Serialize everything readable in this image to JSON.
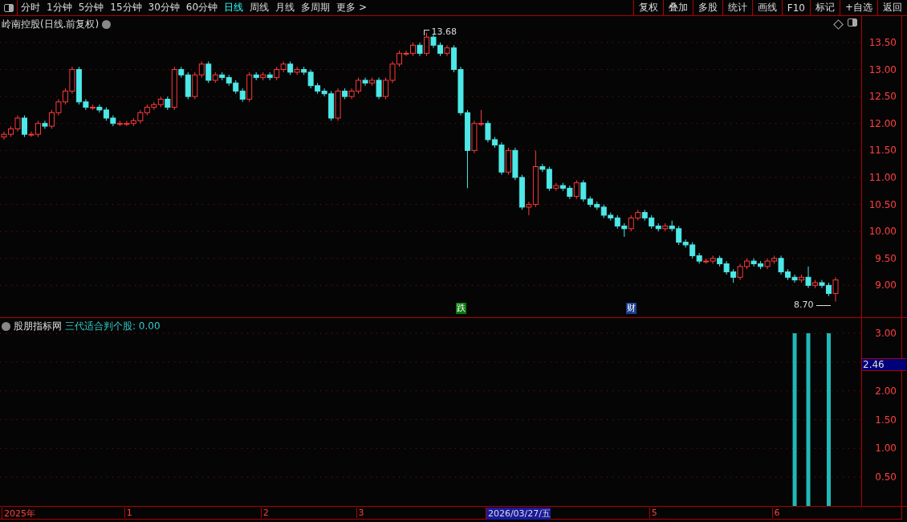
{
  "toolbar": {
    "periods": [
      {
        "label": "分时",
        "selected": false
      },
      {
        "label": "1分钟",
        "selected": false
      },
      {
        "label": "5分钟",
        "selected": false
      },
      {
        "label": "15分钟",
        "selected": false
      },
      {
        "label": "30分钟",
        "selected": false
      },
      {
        "label": "60分钟",
        "selected": false
      },
      {
        "label": "日线",
        "selected": true
      },
      {
        "label": "周线",
        "selected": false
      },
      {
        "label": "月线",
        "selected": false
      },
      {
        "label": "多周期",
        "selected": false
      }
    ],
    "more": "更多 >",
    "actions": [
      "复权",
      "叠加",
      "多股",
      "统计",
      "画线",
      "F10",
      "标记",
      "+自选",
      "返回"
    ]
  },
  "main_panel": {
    "title": "岭南控股(日线.前复权)",
    "chart_data": {
      "type": "candlestick",
      "grid": true,
      "ylim": [
        8.41,
        13.99
      ],
      "yticks": [
        {
          "value": 9,
          "label": "9.00"
        },
        {
          "value": 9.5,
          "label": "9.50"
        },
        {
          "value": 10,
          "label": "10.00"
        },
        {
          "value": 10.5,
          "label": "10.50"
        },
        {
          "value": 11,
          "label": "11.00"
        },
        {
          "value": 11.5,
          "label": "11.50"
        },
        {
          "value": 12,
          "label": "12.00"
        },
        {
          "value": 12.5,
          "label": "12.50"
        },
        {
          "value": 13,
          "label": "13.00"
        },
        {
          "value": 13.5,
          "label": "13.50"
        }
      ],
      "categories": [
        null,
        null,
        null,
        null,
        null,
        null,
        null,
        null,
        null,
        null,
        null,
        null,
        null,
        null,
        null,
        null,
        null,
        null,
        null,
        null,
        null,
        null,
        null,
        null,
        null,
        null,
        null,
        null,
        null,
        null,
        null,
        null,
        null,
        null,
        null,
        null,
        null,
        null,
        null,
        null,
        null,
        null,
        null,
        null,
        null,
        null,
        null,
        null,
        null,
        null,
        null,
        null,
        null,
        null,
        null,
        null,
        null,
        null,
        null,
        null,
        null,
        null,
        null,
        null,
        null,
        null,
        null,
        null,
        null,
        null,
        null,
        null,
        null,
        null,
        null,
        null,
        null,
        null,
        null,
        null,
        null,
        null,
        null,
        null,
        null,
        null,
        null,
        null,
        null,
        null,
        null,
        null,
        null,
        null,
        null,
        null,
        null,
        null,
        null,
        null,
        null,
        null,
        null,
        null,
        null,
        null,
        null,
        null,
        null,
        null,
        null,
        null,
        null,
        null,
        null,
        null,
        null,
        null,
        null,
        null,
        null,
        null,
        null
      ],
      "ohlc": [
        [
          11.75,
          11.85,
          11.7,
          11.8
        ],
        [
          11.8,
          11.95,
          11.75,
          11.9
        ],
        [
          11.9,
          12.15,
          11.85,
          12.1
        ],
        [
          12.1,
          12.15,
          11.75,
          11.8
        ],
        [
          11.8,
          11.85,
          11.75,
          11.8
        ],
        [
          11.8,
          12.05,
          11.75,
          12.0
        ],
        [
          12.0,
          12.05,
          11.9,
          11.95
        ],
        [
          11.95,
          12.25,
          11.9,
          12.2
        ],
        [
          12.2,
          12.45,
          12.15,
          12.4
        ],
        [
          12.4,
          12.65,
          12.35,
          12.6
        ],
        [
          12.6,
          13.05,
          12.55,
          13.0
        ],
        [
          13.0,
          13.05,
          12.35,
          12.4
        ],
        [
          12.4,
          12.45,
          12.25,
          12.3
        ],
        [
          12.3,
          12.35,
          12.25,
          12.3
        ],
        [
          12.3,
          12.35,
          12.2,
          12.25
        ],
        [
          12.25,
          12.3,
          12.05,
          12.1
        ],
        [
          12.1,
          12.15,
          11.95,
          12.0
        ],
        [
          12.0,
          12.05,
          11.95,
          12.0
        ],
        [
          12.0,
          12.05,
          11.95,
          12.0
        ],
        [
          12.0,
          12.1,
          11.95,
          12.05
        ],
        [
          12.05,
          12.25,
          12.0,
          12.2
        ],
        [
          12.2,
          12.35,
          12.15,
          12.3
        ],
        [
          12.3,
          12.4,
          12.25,
          12.35
        ],
        [
          12.35,
          12.5,
          12.3,
          12.45
        ],
        [
          12.45,
          12.5,
          12.25,
          12.3
        ],
        [
          12.3,
          13.05,
          12.25,
          13.0
        ],
        [
          13.0,
          13.05,
          12.85,
          12.9
        ],
        [
          12.9,
          12.95,
          12.45,
          12.5
        ],
        [
          12.5,
          12.95,
          12.45,
          12.9
        ],
        [
          12.9,
          13.15,
          12.85,
          13.1
        ],
        [
          13.1,
          13.15,
          12.75,
          12.8
        ],
        [
          12.8,
          12.95,
          12.75,
          12.9
        ],
        [
          12.9,
          12.95,
          12.8,
          12.85
        ],
        [
          12.85,
          12.9,
          12.7,
          12.75
        ],
        [
          12.75,
          12.8,
          12.55,
          12.6
        ],
        [
          12.6,
          12.65,
          12.4,
          12.45
        ],
        [
          12.45,
          12.95,
          12.4,
          12.9
        ],
        [
          12.9,
          12.95,
          12.8,
          12.85
        ],
        [
          12.85,
          12.95,
          12.8,
          12.9
        ],
        [
          12.9,
          12.95,
          12.8,
          12.85
        ],
        [
          12.85,
          13.05,
          12.8,
          13.0
        ],
        [
          13.0,
          13.15,
          12.95,
          13.1
        ],
        [
          13.1,
          13.15,
          12.9,
          12.95
        ],
        [
          12.95,
          13.05,
          12.9,
          13.0
        ],
        [
          13.0,
          13.05,
          12.9,
          12.95
        ],
        [
          12.95,
          13.0,
          12.65,
          12.7
        ],
        [
          12.7,
          12.75,
          12.55,
          12.6
        ],
        [
          12.6,
          12.65,
          12.5,
          12.55
        ],
        [
          12.55,
          12.6,
          12.05,
          12.1
        ],
        [
          12.1,
          12.65,
          12.05,
          12.6
        ],
        [
          12.6,
          12.65,
          12.45,
          12.5
        ],
        [
          12.5,
          12.65,
          12.45,
          12.6
        ],
        [
          12.6,
          12.85,
          12.55,
          12.8
        ],
        [
          12.8,
          12.85,
          12.7,
          12.75
        ],
        [
          12.75,
          12.85,
          12.7,
          12.8
        ],
        [
          12.8,
          12.85,
          12.45,
          12.5
        ],
        [
          12.5,
          12.85,
          12.45,
          12.8
        ],
        [
          12.8,
          13.15,
          12.75,
          13.1
        ],
        [
          13.1,
          13.35,
          13.05,
          13.3
        ],
        [
          13.3,
          13.35,
          13.25,
          13.3
        ],
        [
          13.3,
          13.5,
          13.25,
          13.45
        ],
        [
          13.45,
          13.5,
          13.25,
          13.3
        ],
        [
          13.3,
          13.68,
          13.25,
          13.6
        ],
        [
          13.6,
          13.65,
          13.4,
          13.45
        ],
        [
          13.45,
          13.5,
          13.25,
          13.3
        ],
        [
          13.3,
          13.45,
          13.25,
          13.4
        ],
        [
          13.4,
          13.45,
          12.95,
          13.0
        ],
        [
          13.0,
          13.05,
          12.15,
          12.2
        ],
        [
          12.2,
          12.25,
          10.8,
          11.5
        ],
        [
          11.5,
          12.05,
          11.45,
          12.0
        ],
        [
          12.0,
          12.25,
          11.95,
          12.0
        ],
        [
          12.0,
          12.05,
          11.65,
          11.7
        ],
        [
          11.7,
          11.75,
          11.55,
          11.6
        ],
        [
          11.6,
          11.65,
          11.05,
          11.1
        ],
        [
          11.1,
          11.55,
          11.05,
          11.5
        ],
        [
          11.5,
          11.55,
          10.95,
          11.0
        ],
        [
          11.0,
          11.05,
          10.4,
          10.45
        ],
        [
          10.45,
          10.55,
          10.3,
          10.5
        ],
        [
          10.5,
          11.5,
          10.45,
          11.2
        ],
        [
          11.2,
          11.25,
          11.1,
          11.15
        ],
        [
          11.15,
          11.2,
          10.75,
          10.8
        ],
        [
          10.8,
          10.9,
          10.75,
          10.85
        ],
        [
          10.85,
          10.9,
          10.75,
          10.8
        ],
        [
          10.8,
          10.85,
          10.6,
          10.65
        ],
        [
          10.65,
          10.95,
          10.6,
          10.9
        ],
        [
          10.9,
          10.95,
          10.55,
          10.6
        ],
        [
          10.6,
          10.65,
          10.45,
          10.5
        ],
        [
          10.5,
          10.55,
          10.4,
          10.45
        ],
        [
          10.45,
          10.5,
          10.25,
          10.3
        ],
        [
          10.3,
          10.35,
          10.2,
          10.25
        ],
        [
          10.25,
          10.3,
          10.05,
          10.1
        ],
        [
          10.1,
          10.15,
          9.9,
          10.05
        ],
        [
          10.05,
          10.3,
          10.0,
          10.25
        ],
        [
          10.25,
          10.4,
          10.2,
          10.35
        ],
        [
          10.35,
          10.4,
          10.2,
          10.25
        ],
        [
          10.25,
          10.3,
          10.05,
          10.1
        ],
        [
          10.1,
          10.15,
          10.0,
          10.05
        ],
        [
          10.05,
          10.15,
          10.0,
          10.1
        ],
        [
          10.1,
          10.2,
          10.0,
          10.05
        ],
        [
          10.05,
          10.1,
          9.75,
          9.8
        ],
        [
          9.8,
          9.85,
          9.7,
          9.75
        ],
        [
          9.75,
          9.8,
          9.5,
          9.55
        ],
        [
          9.55,
          9.6,
          9.4,
          9.45
        ],
        [
          9.45,
          9.5,
          9.4,
          9.45
        ],
        [
          9.45,
          9.55,
          9.4,
          9.5
        ],
        [
          9.5,
          9.55,
          9.35,
          9.4
        ],
        [
          9.4,
          9.45,
          9.2,
          9.25
        ],
        [
          9.25,
          9.3,
          9.05,
          9.15
        ],
        [
          9.15,
          9.4,
          9.1,
          9.35
        ],
        [
          9.35,
          9.5,
          9.3,
          9.45
        ],
        [
          9.45,
          9.5,
          9.35,
          9.4
        ],
        [
          9.4,
          9.45,
          9.3,
          9.35
        ],
        [
          9.35,
          9.5,
          9.3,
          9.45
        ],
        [
          9.45,
          9.55,
          9.4,
          9.5
        ],
        [
          9.5,
          9.55,
          9.2,
          9.25
        ],
        [
          9.25,
          9.3,
          9.1,
          9.15
        ],
        [
          9.15,
          9.2,
          9.05,
          9.1
        ],
        [
          9.1,
          9.2,
          9.05,
          9.15
        ],
        [
          9.15,
          9.35,
          8.95,
          9.0
        ],
        [
          9.0,
          9.1,
          8.95,
          9.05
        ],
        [
          9.05,
          9.1,
          8.95,
          9.0
        ],
        [
          9.0,
          9.05,
          8.8,
          8.85
        ],
        [
          8.85,
          9.15,
          8.7,
          9.1
        ]
      ],
      "annotations": [
        "13.68",
        "8.70"
      ]
    },
    "events": [
      {
        "label": "跌",
        "color": "#0a7a0a"
      },
      {
        "label": "财",
        "color": "#1a3f8f"
      }
    ]
  },
  "indicator_panel": {
    "source": "股朋指标网",
    "formula": "三代适合判个股: 0.00",
    "cursor_value": "2.46",
    "chart_data": {
      "type": "bar",
      "grid": true,
      "ylim": [
        0,
        3
      ],
      "categories": [
        null,
        null,
        null,
        null,
        null,
        null,
        null,
        null,
        null,
        null,
        null,
        null,
        null,
        null,
        null,
        null,
        null,
        null,
        null,
        null,
        null,
        null,
        null,
        null,
        null,
        null,
        null,
        null,
        null,
        null,
        null,
        null,
        null,
        null,
        null,
        null,
        null,
        null,
        null,
        null,
        null,
        null,
        null,
        null,
        null,
        null,
        null,
        null,
        null,
        null,
        null,
        null,
        null,
        null,
        null,
        null,
        null,
        null,
        null,
        null,
        null,
        null,
        null,
        null,
        null,
        null,
        null,
        null,
        null,
        null,
        null,
        null,
        null,
        null,
        null,
        null,
        null,
        null,
        null,
        null,
        null,
        null,
        null,
        null,
        null,
        null,
        null,
        null,
        null,
        null,
        null,
        null,
        null,
        null,
        null,
        null,
        null,
        null,
        null,
        null,
        null,
        null,
        null,
        null,
        null,
        null,
        null,
        null,
        null,
        null,
        null,
        null,
        null,
        null,
        null,
        null,
        null,
        null,
        null,
        null,
        null,
        null,
        null
      ],
      "values": [
        null,
        null,
        null,
        null,
        null,
        null,
        null,
        null,
        null,
        null,
        null,
        null,
        null,
        null,
        null,
        null,
        null,
        null,
        null,
        null,
        null,
        null,
        null,
        null,
        null,
        null,
        null,
        null,
        null,
        null,
        null,
        null,
        null,
        null,
        null,
        null,
        null,
        null,
        null,
        null,
        null,
        null,
        null,
        null,
        null,
        null,
        null,
        null,
        null,
        null,
        null,
        null,
        null,
        null,
        null,
        null,
        null,
        null,
        null,
        null,
        null,
        null,
        null,
        null,
        null,
        null,
        null,
        null,
        null,
        null,
        null,
        null,
        null,
        null,
        null,
        null,
        null,
        null,
        null,
        null,
        null,
        null,
        null,
        null,
        null,
        null,
        null,
        null,
        null,
        null,
        null,
        null,
        null,
        null,
        null,
        null,
        null,
        null,
        null,
        null,
        null,
        null,
        null,
        null,
        null,
        null,
        null,
        null,
        null,
        null,
        null,
        null,
        null,
        null,
        null,
        null,
        3,
        null,
        3,
        null,
        null,
        3,
        null
      ],
      "yticks": [
        {
          "value": 0.5,
          "label": "0.50"
        },
        {
          "value": 1,
          "label": "1.00"
        },
        {
          "value": 1.5,
          "label": "1.50"
        },
        {
          "value": 2,
          "label": "2.00"
        },
        {
          "value": 3,
          "label": "3.00"
        }
      ]
    }
  },
  "date_axis": {
    "labels": [
      "2025年",
      "1",
      "2",
      "3",
      "5",
      "6"
    ],
    "cursor_date": "2026/03/27/五"
  }
}
